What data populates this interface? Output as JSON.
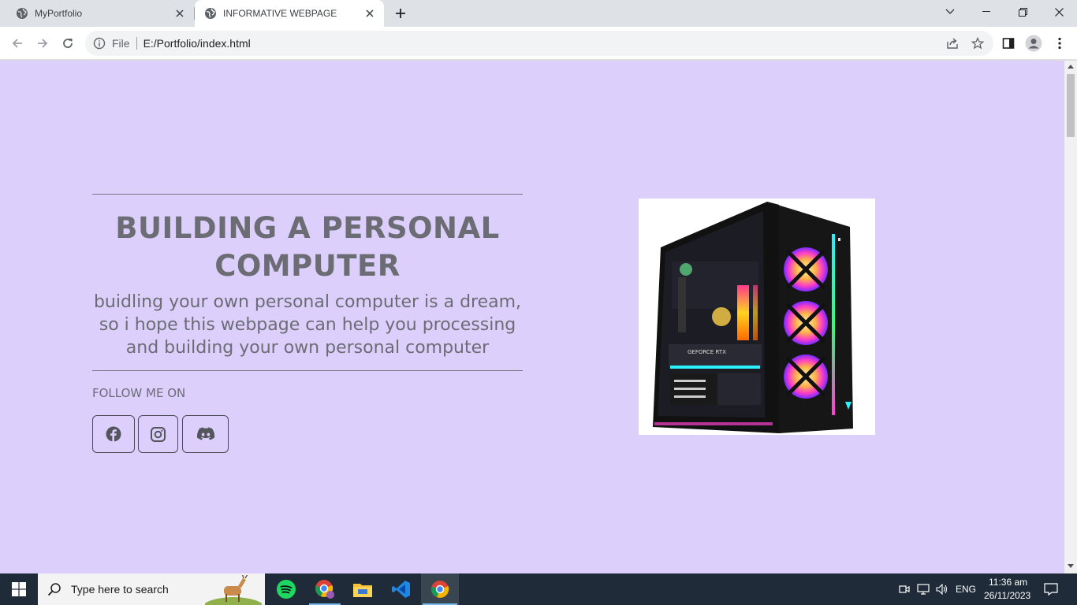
{
  "browser": {
    "tabs": [
      {
        "label": "MyPortfolio",
        "active": false
      },
      {
        "label": "INFORMATIVE WEBPAGE",
        "active": true
      }
    ],
    "omnibox": {
      "scheme": "File",
      "url": "E:/Portfolio/index.html"
    }
  },
  "page": {
    "background": "#dccffc",
    "headline": "BUILDING A PERSONAL COMPUTER",
    "subline": "buidling your own personal computer is a dream, so i hope this webpage can help you processing and building your own personal computer",
    "follow_label": "FOLLOW ME ON",
    "social": [
      {
        "name": "facebook",
        "icon": "facebook-icon"
      },
      {
        "name": "instagram",
        "icon": "instagram-icon"
      },
      {
        "name": "discord",
        "icon": "discord-icon"
      }
    ],
    "image": {
      "subject": "gaming-pc-case",
      "caption": "GEFORCE RTX"
    }
  },
  "taskbar": {
    "search_placeholder": "Type here to search",
    "apps": [
      "spotify-icon",
      "chrome-profile-icon",
      "file-explorer-icon",
      "vscode-icon",
      "chrome-icon"
    ],
    "tray": {
      "language": "ENG",
      "time": "11:36 am",
      "date": "26/11/2023"
    }
  },
  "colors": {
    "accent": "#76b9ed",
    "text_muted": "#6b6c74",
    "taskbar": "#1f2b38"
  }
}
